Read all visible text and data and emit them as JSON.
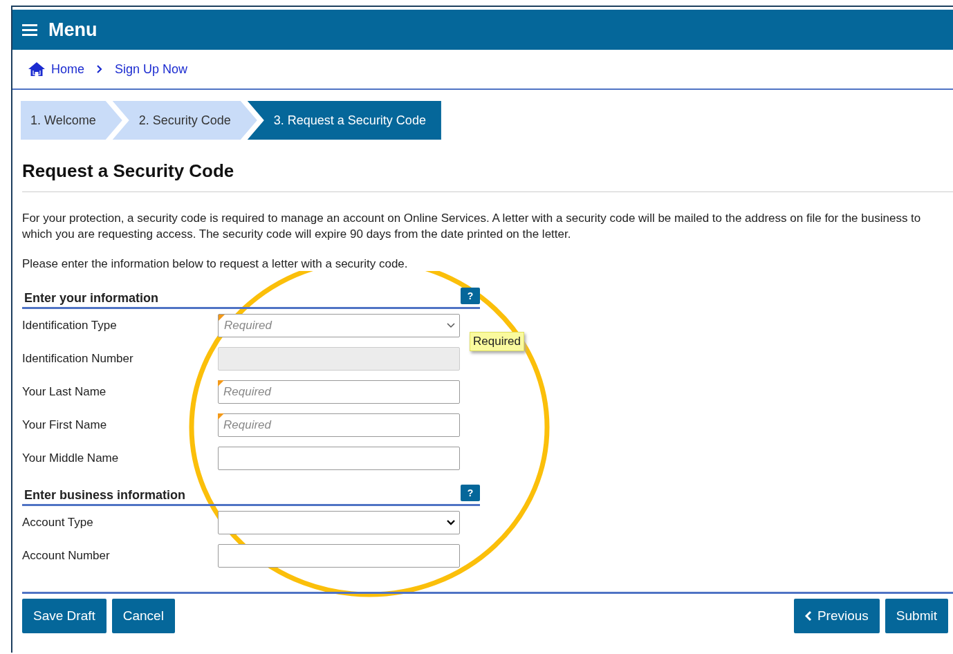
{
  "header": {
    "title": "Menu"
  },
  "breadcrumb": [
    {
      "label": "Home",
      "kind": "home"
    },
    {
      "label": "Sign Up Now",
      "kind": "link"
    }
  ],
  "steps": [
    {
      "label": "1. Welcome",
      "selected": false
    },
    {
      "label": "2. Security Code",
      "selected": false
    },
    {
      "label": "3. Request a Security Code",
      "selected": true
    }
  ],
  "page_title": "Request a Security Code",
  "intro": "For your protection, a security code is required to manage an account on Online Services. A letter with a security code will be mailed to the address on file for the business to which you are requesting access. The security code will expire 90 days from the date printed on the letter.",
  "instruction": "Please enter the information below to request a letter with a security code.",
  "sections": [
    {
      "title": "Enter your information",
      "help": "?",
      "fields": [
        {
          "label": "Identification Type",
          "kind": "select",
          "placeholder": "Required",
          "required": true,
          "disabled": false,
          "tooltip": "Required"
        },
        {
          "label": "Identification Number",
          "kind": "text",
          "required": false,
          "disabled": true
        },
        {
          "label": "Your Last Name",
          "kind": "text",
          "placeholder": "Required",
          "required": true,
          "disabled": false
        },
        {
          "label": "Your First Name",
          "kind": "text",
          "placeholder": "Required",
          "required": true,
          "disabled": false
        },
        {
          "label": "Your Middle Name",
          "kind": "text",
          "required": false,
          "disabled": false
        }
      ]
    },
    {
      "title": "Enter business information",
      "help": "?",
      "fields": [
        {
          "label": "Account Type",
          "kind": "select",
          "required": false,
          "disabled": false
        },
        {
          "label": "Account Number",
          "kind": "text",
          "required": false,
          "disabled": false
        }
      ]
    }
  ],
  "buttons_left": [
    "Save Draft",
    "Cancel"
  ],
  "buttons_right": [
    {
      "label": "Previous",
      "kind": "back"
    },
    {
      "label": "Submit",
      "kind": "plain"
    }
  ],
  "annotation": {
    "kind": "circle"
  }
}
